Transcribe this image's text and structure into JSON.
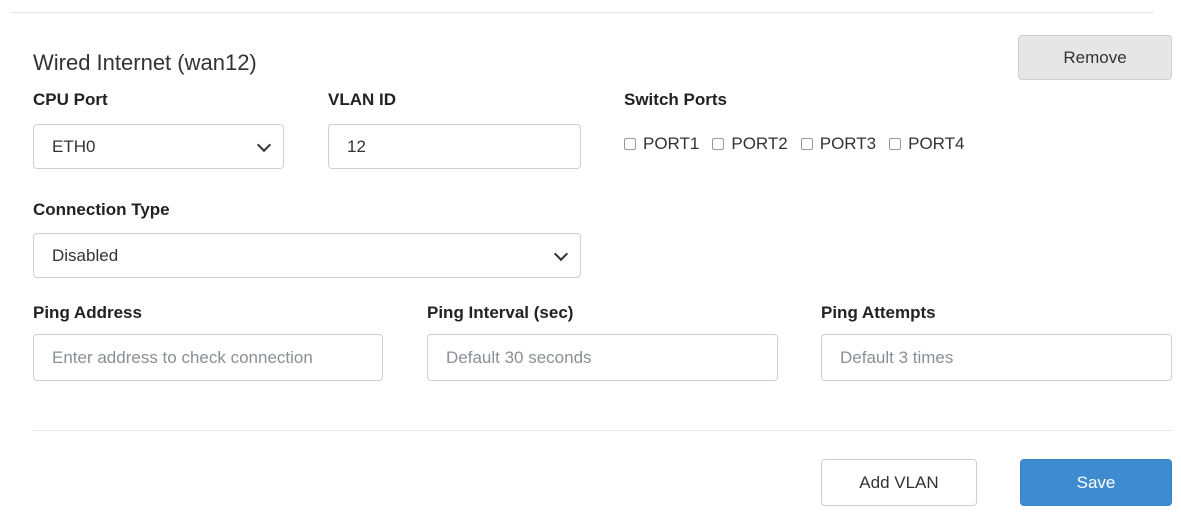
{
  "card": {
    "title": "Wired Internet (wan12)",
    "remove_label": "Remove"
  },
  "cpu_port": {
    "label": "CPU Port",
    "value": "ETH0"
  },
  "vlan_id": {
    "label": "VLAN ID",
    "value": "12"
  },
  "switch_ports": {
    "label": "Switch Ports",
    "ports": [
      {
        "label": "PORT1",
        "checked": false
      },
      {
        "label": "PORT2",
        "checked": false
      },
      {
        "label": "PORT3",
        "checked": false
      },
      {
        "label": "PORT4",
        "checked": false
      }
    ]
  },
  "connection_type": {
    "label": "Connection Type",
    "value": "Disabled"
  },
  "ping_address": {
    "label": "Ping Address",
    "placeholder": "Enter address to check connection"
  },
  "ping_interval": {
    "label": "Ping Interval (sec)",
    "placeholder": "Default 30 seconds"
  },
  "ping_attempts": {
    "label": "Ping Attempts",
    "placeholder": "Default 3 times"
  },
  "footer": {
    "add_vlan_label": "Add VLAN",
    "save_label": "Save"
  },
  "colors": {
    "primary": "#3f8bcf",
    "secondary_bg": "#e6e6e6",
    "border": "#ccd0d5"
  },
  "icons": {
    "select_caret": "chevron-down-icon",
    "checkbox": "checkbox-icon"
  }
}
